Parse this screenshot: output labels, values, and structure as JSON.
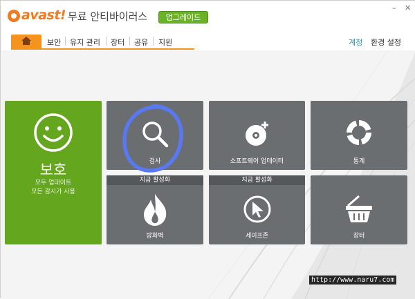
{
  "app": {
    "logo_text": "avast!",
    "title": "무료 안티바이러스",
    "upgrade_label": "업그레이드",
    "minimize_glyph": "–",
    "close_glyph": "✕"
  },
  "nav": {
    "home_icon": "home-icon",
    "items": [
      "보안",
      "유지 관리",
      "장터",
      "공유",
      "지원"
    ],
    "account_label": "계정",
    "settings_label": "환경 설정"
  },
  "status": {
    "icon": "smiley-icon",
    "title": "보호",
    "line1": "모두 업데이트",
    "line2": "모든 감시가 사용"
  },
  "tiles": {
    "scan": {
      "label": "검사",
      "icon": "magnifier-icon"
    },
    "software_updater": {
      "label": "소프트웨어 업데이터",
      "icon": "disc-plus-icon"
    },
    "statistics": {
      "label": "통계",
      "icon": "ring-chart-icon"
    },
    "firewall": {
      "header": "지금 활성화",
      "label": "방화벽",
      "icon": "flame-icon"
    },
    "safezone": {
      "header": "지금 활성화",
      "label": "세이프존",
      "icon": "cursor-icon"
    },
    "market": {
      "label": "장터",
      "icon": "basket-icon"
    }
  },
  "watermark": "http://www.naru7.com",
  "colors": {
    "brand_orange": "#f47a20",
    "upgrade_green": "#6ab327",
    "status_green": "#65a61f",
    "tile_gray": "#6b6e71",
    "link_blue": "#2a8fb3",
    "annotation_blue": "#5a78f0"
  }
}
